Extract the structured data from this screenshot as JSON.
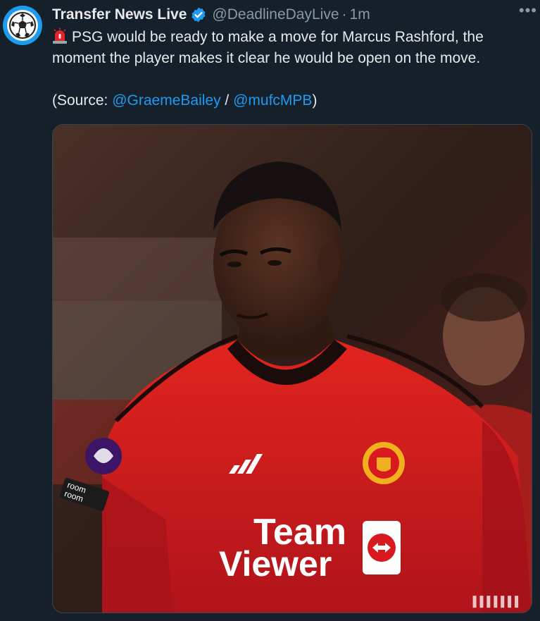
{
  "tweet": {
    "display_name": "Transfer News Live",
    "handle": "@DeadlineDayLive",
    "separator": "·",
    "time": "1m",
    "more_icon": "more-horizontal-icon",
    "text": "PSG would be ready to make a move for Marcus Rashford, the moment the player makes it clear he would be open on the move.",
    "source_prefix": "(Source: ",
    "source_link_1": "@GraemeBailey",
    "source_separator": " / ",
    "source_link_2": "@mufcMPB",
    "source_suffix": ")"
  },
  "media": {
    "shirt_sponsor_line1": "Team",
    "shirt_sponsor_line2": "Viewer",
    "sleeve_text": "room\nroom"
  },
  "colors": {
    "background": "#15202b",
    "text": "#e7e9ea",
    "muted": "#8b98a5",
    "link": "#1d9bf0",
    "verified": "#1d9bf0",
    "shirt_red": "#d8191f"
  }
}
